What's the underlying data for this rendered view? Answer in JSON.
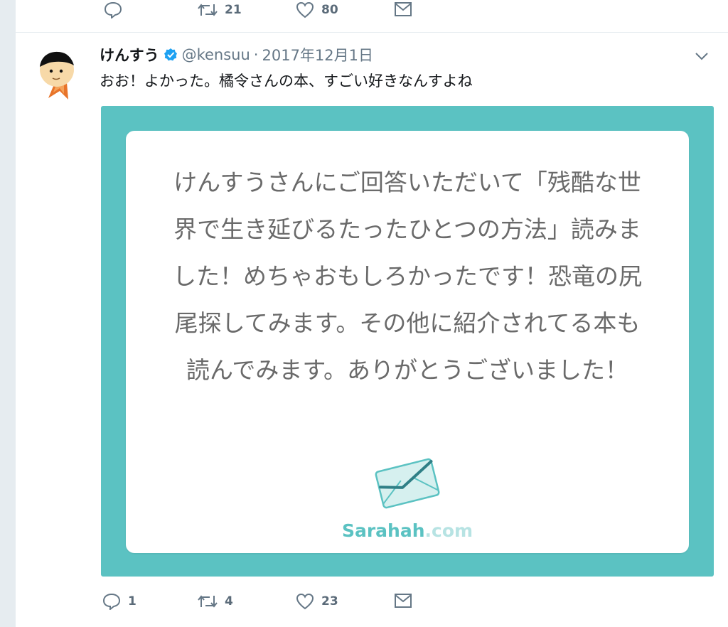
{
  "previous_tweet": {
    "reply_count": "",
    "retweet_count": "21",
    "like_count": "80"
  },
  "tweet": {
    "display_name": "けんすう",
    "handle": "@kensuu",
    "separator": "·",
    "date": "2017年12月1日",
    "text": "おお！よかった。橘令さんの本、すごい好きなんすよね",
    "card": {
      "message": "けんすうさんにご回答いただいて「残酷な世界で生き延びるたったひとつの方法」読みました！めちゃおもしろかったです！恐竜の尻尾探してみます。その他に紹介されてる本も読んでみます。ありがとうございました！",
      "brand_main": "Sarahah",
      "brand_suffix": ".com"
    },
    "reply_count": "1",
    "retweet_count": "4",
    "like_count": "23"
  },
  "colors": {
    "card_teal": "#5bc2c2",
    "icon_gray": "#657786",
    "verified_blue": "#1da1f2"
  },
  "icons": {
    "reply": "reply-icon",
    "retweet": "retweet-icon",
    "like": "heart-icon",
    "dm": "mail-icon",
    "menu": "chevron-down-icon",
    "verified": "verified-badge-icon"
  }
}
